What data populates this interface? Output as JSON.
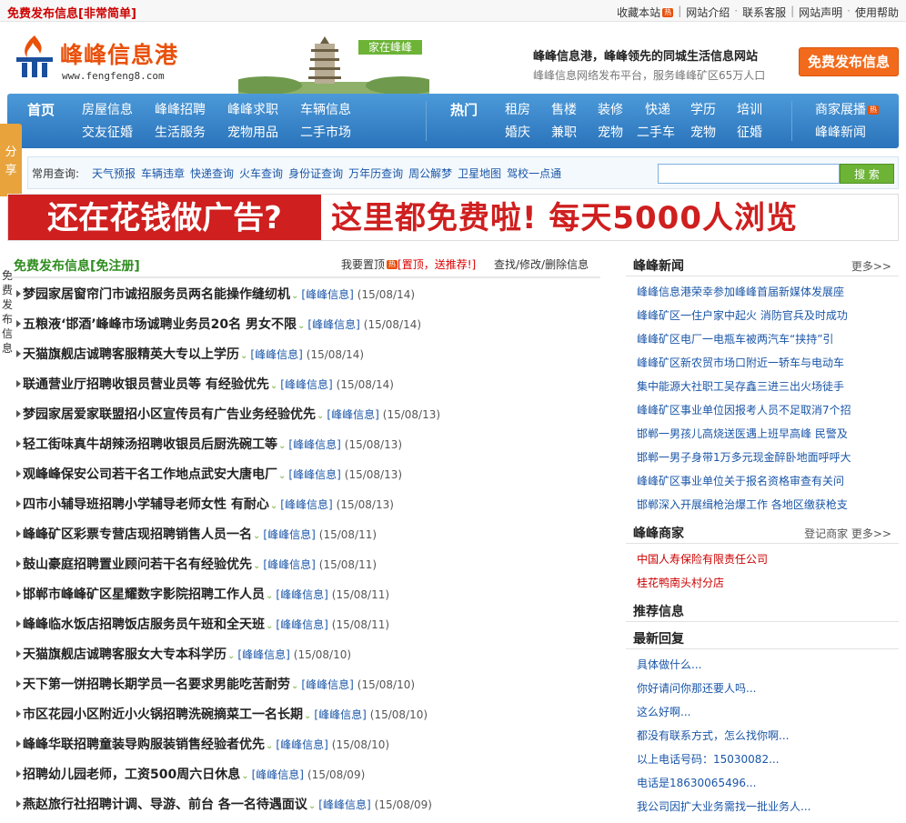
{
  "topbar": {
    "left_text": "免费发布信息[非常简单]",
    "links": [
      "收藏本站",
      "网站介绍",
      "联系客服",
      "网站声明",
      "使用帮助"
    ],
    "hot_badge": "热"
  },
  "header": {
    "logo_name": "峰峰信息港",
    "logo_url": "www.fengfeng8.com",
    "pagoda_badge": "家在峰峰",
    "slogan": "峰峰信息港，峰峰领先的同城生活信息网站",
    "subslogan": "峰峰信息网络发布平台，服务峰峰矿区65万人口",
    "post_button": "免费发布信息"
  },
  "nav": {
    "col1": [
      "首页",
      "房屋信息",
      "峰峰招聘",
      "峰峰求职",
      "车辆信息"
    ],
    "col1b": [
      "交友征婚",
      "生活服务",
      "宠物用品",
      "二手市场"
    ],
    "hot_label": "热门",
    "col2": [
      "租房",
      "售楼",
      "装修",
      "快递",
      "学历",
      "培训"
    ],
    "col2b": [
      "婚庆",
      "兼职",
      "宠物",
      "二手车",
      "宠物",
      "征婚"
    ],
    "col3": [
      "商家展播",
      "峰峰新闻"
    ],
    "hot_badge": "热"
  },
  "share": "分享",
  "query": {
    "label": "常用查询:",
    "items": [
      "天气预报",
      "车辆违章",
      "快递查询",
      "火车查询",
      "身份证查询",
      "万年历查询",
      "周公解梦",
      "卫星地图",
      "驾校一点通"
    ],
    "search_placeholder": "",
    "search_button": "搜 索"
  },
  "banner": {
    "left": "还在花钱做广告?",
    "right": "这里都免费啦! 每天5000人浏览"
  },
  "side_tag": "免费发布信息",
  "main": {
    "title": "免费发布信息[免注册]",
    "middle_pre": "我要置顶",
    "middle_red": "[置顶，送推荐!]",
    "right": "查找/修改/删除信息",
    "source_label": "[峰峰信息]",
    "items": [
      {
        "title": "梦园家居窗帘门市诚招服务员两名能操作缝纫机",
        "date": "(15/08/14)"
      },
      {
        "title": "五粮液‘邯酒’峰峰市场诚聘业务员20名 男女不限",
        "date": "(15/08/14)"
      },
      {
        "title": "天猫旗舰店诚聘客服精英大专以上学历",
        "date": "(15/08/14)"
      },
      {
        "title": "联通营业厅招聘收银员营业员等 有经验优先",
        "date": "(15/08/14)"
      },
      {
        "title": "梦园家居爱家联盟招小区宣传员有广告业务经验优先",
        "date": "(15/08/13)"
      },
      {
        "title": "轻工街味真牛胡辣汤招聘收银员后厨洗碗工等",
        "date": "(15/08/13)"
      },
      {
        "title": "观峰峰保安公司若干名工作地点武安大唐电厂",
        "date": "(15/08/13)"
      },
      {
        "title": "四市小辅导班招聘小学辅导老师女性 有耐心",
        "date": "(15/08/13)"
      },
      {
        "title": "峰峰矿区彩票专营店现招聘销售人员一名",
        "date": "(15/08/11)"
      },
      {
        "title": "鼓山豪庭招聘置业顾问若干名有经验优先",
        "date": "(15/08/11)"
      },
      {
        "title": "邯郸市峰峰矿区星耀数字影院招聘工作人员",
        "date": "(15/08/11)"
      },
      {
        "title": "峰峰临水饭店招聘饭店服务员午班和全天班",
        "date": "(15/08/11)"
      },
      {
        "title": "天猫旗舰店诚聘客服女大专本科学历",
        "date": "(15/08/10)"
      },
      {
        "title": "天下第一饼招聘长期学员一名要求男能吃苦耐劳",
        "date": "(15/08/10)"
      },
      {
        "title": "市区花园小区附近小火锅招聘洗碗摘菜工一名长期",
        "date": "(15/08/10)"
      },
      {
        "title": "峰峰华联招聘童装导购服装销售经验者优先",
        "date": "(15/08/10)"
      },
      {
        "title": "招聘幼儿园老师，工资500周六日休息",
        "date": "(15/08/09)"
      },
      {
        "title": "燕赵旅行社招聘计调、导游、前台 各一名待遇面议",
        "date": "(15/08/09)"
      }
    ]
  },
  "right": {
    "news_title": "峰峰新闻",
    "news_more": "更多>>",
    "news": [
      "峰峰信息港荣幸参加峰峰首届新媒体发展座",
      "峰峰矿区一住户家中起火 消防官兵及时成功",
      "峰峰矿区电厂一电瓶车被两汽车“挟持”引",
      "峰峰矿区新农贸市场口附近一轿车与电动车",
      "集中能源大社职工吴存鑫三进三出火场徒手",
      "峰峰矿区事业单位因报考人员不足取消7个招",
      "邯郸一男孩儿高烧送医遇上班早高峰 民警及",
      "邯郸一男子身带1万多元现金醉卧地面呼呼大",
      "峰峰矿区事业单位关于报名资格审查有关问",
      "邯郸深入开展缉枪治爆工作 各地区缴获枪支"
    ],
    "merchant_title": "峰峰商家",
    "merchant_more": "登记商家 更多>>",
    "merchants": [
      "中国人寿保险有限责任公司",
      "桂花鸭南头村分店"
    ],
    "recommend_title": "推荐信息",
    "reply_title": "最新回复",
    "replies": [
      "具体做什么...",
      "你好请问你那还要人吗...",
      "这么好啊...",
      "都没有联系方式，怎么找你啊...",
      "以上电话号码：15030082...",
      "电话是18630065496...",
      "我公司因扩大业务需找一批业务人..."
    ]
  },
  "colors": {
    "accent": "#e8510b",
    "nav": "#2a73bb",
    "green": "#2f8c1f",
    "link": "#1a56a8",
    "red": "#cf1f1f"
  }
}
